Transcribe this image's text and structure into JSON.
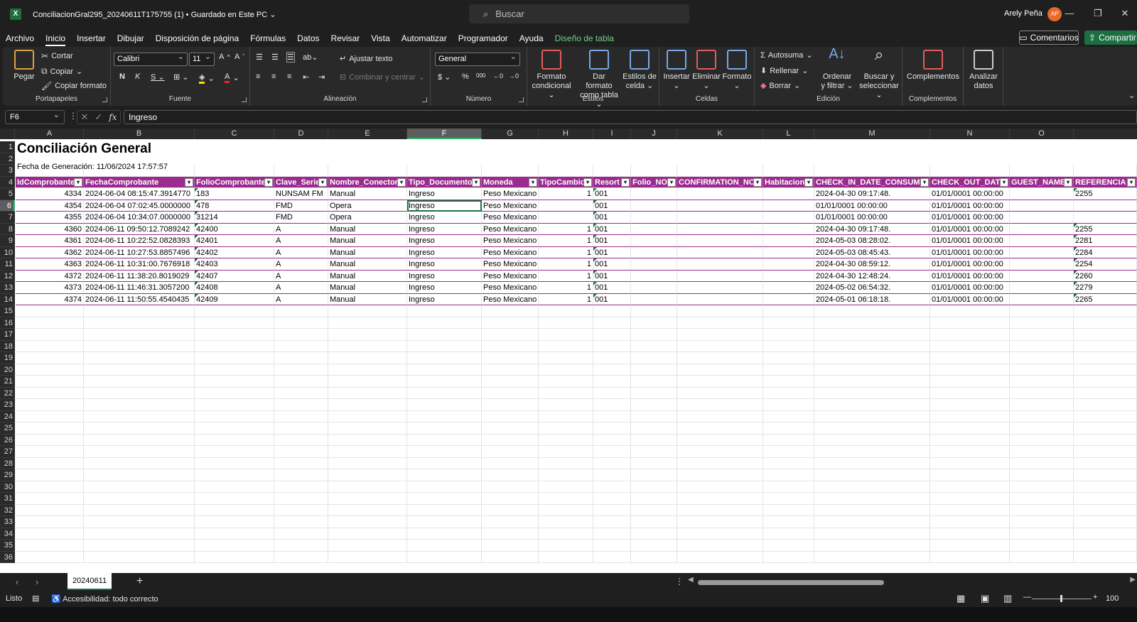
{
  "titlebar": {
    "file_name": "ConciliacionGral295_20240611T175755 (1) • Guardado en Este PC ⌄",
    "search_placeholder": "Buscar",
    "user_name": "Arely Peña",
    "user_initials": "AP"
  },
  "menu": {
    "items": [
      "Archivo",
      "Inicio",
      "Insertar",
      "Dibujar",
      "Disposición de página",
      "Fórmulas",
      "Datos",
      "Revisar",
      "Vista",
      "Automatizar",
      "Programador",
      "Ayuda",
      "Diseño de tabla"
    ],
    "comments": "Comentarios",
    "share": "Compartir"
  },
  "ribbon": {
    "clipboard": {
      "paste": "Pegar",
      "cut": "Cortar",
      "copy": "Copiar",
      "format_painter": "Copiar formato",
      "label": "Portapapeles"
    },
    "font": {
      "name": "Calibri",
      "size": "11",
      "label": "Fuente"
    },
    "alignment": {
      "wrap": "Ajustar texto",
      "merge": "Combinar y centrar",
      "label": "Alineación"
    },
    "number": {
      "format": "General",
      "label": "Número"
    },
    "styles": {
      "conditional": "Formato condicional",
      "as_table": "Dar formato como tabla",
      "cell_styles": "Estilos de celda",
      "label": "Estilos"
    },
    "cells": {
      "insert": "Insertar",
      "delete": "Eliminar",
      "format": "Formato",
      "label": "Celdas"
    },
    "editing": {
      "autosum": "Autosuma",
      "fill": "Rellenar",
      "clear": "Borrar",
      "sort": "Ordenar y filtrar",
      "find": "Buscar y seleccionar",
      "label": "Edición"
    },
    "addins": {
      "addins": "Complementos",
      "label": "Complementos"
    },
    "analyze": {
      "label": "Analizar datos"
    }
  },
  "formula_bar": {
    "name_box": "F6",
    "formula": "Ingreso"
  },
  "sheet": {
    "title": "Conciliación General",
    "subtitle": "Fecha de Generación: 11/06/2024 17:57:57",
    "columns": [
      "A",
      "B",
      "C",
      "D",
      "E",
      "F",
      "G",
      "H",
      "I",
      "J",
      "K",
      "L",
      "M",
      "N",
      "O"
    ],
    "selected_column": "F",
    "selected_row": "6",
    "headers": [
      "IdComprobante",
      "FechaComprobante",
      "FolioComprobante",
      "Clave_Serie",
      "Nombre_Conector",
      "Tipo_Documento",
      "Moneda",
      "TipoCambio",
      "Resort",
      "Folio_NO",
      "CONFIRMATION_NO",
      "Habitacion",
      "CHECK_IN_DATE_CONSUMO",
      "CHECK_OUT_DATE",
      "GUEST_NAME",
      "REFERENCIA"
    ],
    "rows": [
      [
        "4334",
        "2024-06-04 08:15:47.3914770",
        "183",
        "NUNSAM FM",
        "Manual",
        "Ingreso",
        "Peso Mexicano",
        "1",
        "001",
        "",
        "",
        "",
        "2024-04-30 09:17:48.",
        "01/01/0001 00:00:00",
        "",
        "2255"
      ],
      [
        "4354",
        "2024-06-04 07:02:45.0000000",
        "478",
        "FMD",
        "Opera",
        "Ingreso",
        "Peso Mexicano",
        "",
        "001",
        "",
        "",
        "",
        "01/01/0001 00:00:00",
        "01/01/0001 00:00:00",
        "",
        ""
      ],
      [
        "4355",
        "2024-06-04 10:34:07.0000000",
        "31214",
        "FMD",
        "Opera",
        "Ingreso",
        "Peso Mexicano",
        "",
        "001",
        "",
        "",
        "",
        "01/01/0001 00:00:00",
        "01/01/0001 00:00:00",
        "",
        ""
      ],
      [
        "4360",
        "2024-06-11 09:50:12.7089242",
        "42400",
        "A",
        "Manual",
        "Ingreso",
        "Peso Mexicano",
        "1",
        "001",
        "",
        "",
        "",
        "2024-04-30 09:17:48.",
        "01/01/0001 00:00:00",
        "",
        "2255"
      ],
      [
        "4361",
        "2024-06-11 10:22:52.0828393",
        "42401",
        "A",
        "Manual",
        "Ingreso",
        "Peso Mexicano",
        "1",
        "001",
        "",
        "",
        "",
        "2024-05-03 08:28:02.",
        "01/01/0001 00:00:00",
        "",
        "2281"
      ],
      [
        "4362",
        "2024-06-11 10:27:53.8857496",
        "42402",
        "A",
        "Manual",
        "Ingreso",
        "Peso Mexicano",
        "1",
        "001",
        "",
        "",
        "",
        "2024-05-03 08:45:43.",
        "01/01/0001 00:00:00",
        "",
        "2284"
      ],
      [
        "4363",
        "2024-06-11 10:31:00.7676918",
        "42403",
        "A",
        "Manual",
        "Ingreso",
        "Peso Mexicano",
        "1",
        "001",
        "",
        "",
        "",
        "2024-04-30 08:59:12.",
        "01/01/0001 00:00:00",
        "",
        "2254"
      ],
      [
        "4372",
        "2024-06-11 11:38:20.8019029",
        "42407",
        "A",
        "Manual",
        "Ingreso",
        "Peso Mexicano",
        "1",
        "001",
        "",
        "",
        "",
        "2024-04-30 12:48:24.",
        "01/01/0001 00:00:00",
        "",
        "2260"
      ],
      [
        "4373",
        "2024-06-11 11:46:31.3057200",
        "42408",
        "A",
        "Manual",
        "Ingreso",
        "Peso Mexicano",
        "1",
        "001",
        "",
        "",
        "",
        "2024-05-02 06:54:32.",
        "01/01/0001 00:00:00",
        "",
        "2279"
      ],
      [
        "4374",
        "2024-06-11 11:50:55.4540435",
        "42409",
        "A",
        "Manual",
        "Ingreso",
        "Peso Mexicano",
        "1",
        "001",
        "",
        "",
        "",
        "2024-05-01 06:18:18.",
        "01/01/0001 00:00:00",
        "",
        "2265"
      ]
    ],
    "row_numbers": [
      "1",
      "2",
      "3",
      "4",
      "5",
      "6",
      "7",
      "8",
      "9",
      "10",
      "11",
      "12",
      "13",
      "14",
      "15",
      "16",
      "17",
      "18",
      "19",
      "20",
      "21",
      "22",
      "23",
      "24",
      "25",
      "26",
      "27",
      "28",
      "29",
      "30",
      "31",
      "32",
      "33",
      "34",
      "35",
      "36"
    ]
  },
  "tabs": {
    "active": "20240611"
  },
  "status": {
    "ready": "Listo",
    "accessibility": "Accesibilidad: todo correcto",
    "zoom": "100"
  }
}
